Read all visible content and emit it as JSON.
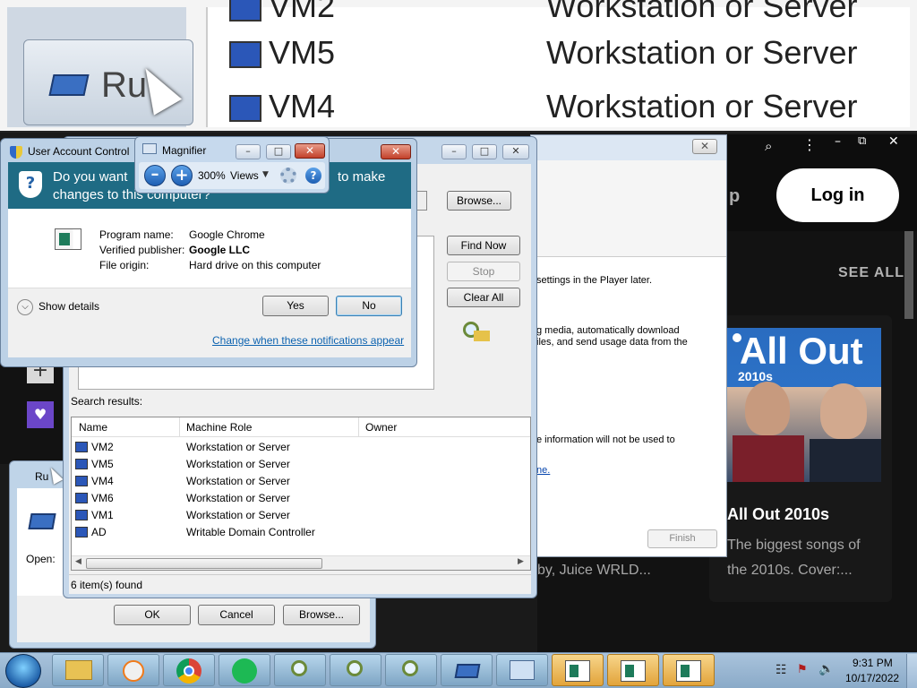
{
  "zoom_strip": {
    "run_label": "Ru",
    "rows": [
      {
        "name": "VM2",
        "role": "Workstation or Server"
      },
      {
        "name": "VM5",
        "role": "Workstation or Server"
      },
      {
        "name": "VM4",
        "role": "Workstation or Server"
      }
    ]
  },
  "uac": {
    "title": "User Account Control",
    "question_start": "Do you want",
    "question_end": "to make",
    "question_line2": "changes to this computer?",
    "program_name_label": "Program name:",
    "program_name_value": "Google Chrome",
    "publisher_label": "Verified publisher:",
    "publisher_value": "Google LLC",
    "origin_label": "File origin:",
    "origin_value": "Hard drive on this computer",
    "show_details": "Show details",
    "yes": "Yes",
    "no": "No",
    "change_link": "Change when these notifications appear"
  },
  "magnifier": {
    "title": "Magnifier",
    "zoom": "300%",
    "views": "Views"
  },
  "find": {
    "browse": "Browse...",
    "find_now": "Find Now",
    "stop": "Stop",
    "clear_all": "Clear All",
    "search_results_label": "Search results:",
    "columns": [
      "Name",
      "Machine Role",
      "Owner"
    ],
    "rows": [
      {
        "name": "VM2",
        "role": "Workstation or Server"
      },
      {
        "name": "VM5",
        "role": "Workstation or Server"
      },
      {
        "name": "VM4",
        "role": "Workstation or Server"
      },
      {
        "name": "VM6",
        "role": "Workstation or Server"
      },
      {
        "name": "VM1",
        "role": "Workstation or Server"
      },
      {
        "name": "AD",
        "role": "Writable Domain Controller"
      }
    ],
    "status": "6 item(s) found"
  },
  "wmp": {
    "line1": "settings in the Player later.",
    "line2": "g media, automatically download",
    "line3": "iles, and send usage data from the",
    "line4": "e information will not be used to",
    "link": "ne.",
    "finish": "Finish"
  },
  "spotify": {
    "login": "Log in",
    "p_fragment": "p",
    "see_all": "SEE ALL",
    "cover_title": "All Out",
    "cover_sub": "2010s",
    "playlist_title": "All Out 2010s",
    "playlist_desc_line1": "The biggest songs of",
    "playlist_desc_line2": "the 2010s. Cover:...",
    "artist_snippet": "by, Juice WRLD..."
  },
  "run": {
    "title": "Ru",
    "open_label": "Open:",
    "ok": "OK",
    "cancel": "Cancel",
    "browse": "Browse..."
  },
  "taskbar": {
    "time": "9:31 PM",
    "date": "10/17/2022"
  }
}
